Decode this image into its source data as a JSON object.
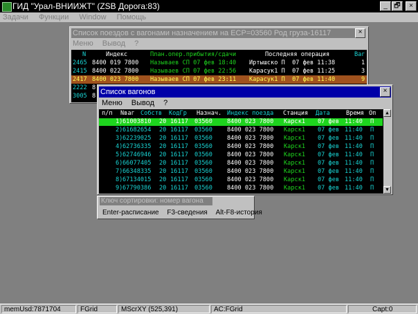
{
  "window": {
    "title": "ГИД \"Урал-ВНИИЖТ\" (ZSB Дорога:83)",
    "buttons": {
      "minimize": "_",
      "restore": "🗗",
      "close": "×"
    }
  },
  "menu": [
    "Задачи",
    "Функции",
    "Window",
    "Помощь"
  ],
  "trains": {
    "title": "Список поездов с вагонами назначением на ЕСР=03560 Род груза-16117",
    "menu": [
      "Меню",
      "Вывод",
      "?"
    ],
    "headers": [
      "N",
      "Индекс",
      "План.опер.прибытия/сдачи",
      "Последняя операция",
      "Ваг"
    ],
    "rows": [
      {
        "n": "2465",
        "index": "8400 019 7800",
        "plan": "Называев СП 07 фев 18:40",
        "last": "Иртышско П  07 фев 11:38",
        "vag": "1"
      },
      {
        "n": "2415",
        "index": "8400 022 7800",
        "plan": "Называев СП 07 фев 22:56",
        "last": "Карасук1 П  07 фев 11:25",
        "vag": "3"
      },
      {
        "n": "2417",
        "index": "8400 023 7800",
        "plan": "Называев СП 07 фев 23:11",
        "last": "Карасук1 П  07 фев 11:40",
        "vag": "9"
      },
      {
        "n": "2222",
        "index": "8",
        "plan": "",
        "last": "",
        "vag": ""
      },
      {
        "n": "3005",
        "index": "8",
        "plan": "",
        "last": "",
        "vag": ""
      }
    ],
    "colors": {
      "number": "#19d4d4",
      "index": "#ffffff",
      "plan": "#1ed41e",
      "last": "#ffffff",
      "selected_bg": "#a0521e",
      "selected_fg": "#ffff55"
    }
  },
  "wagons": {
    "title": "Список вагонов",
    "menu": [
      "Меню",
      "Вывод",
      "?"
    ],
    "headers": [
      "п/п",
      "Nваг",
      "Собств",
      "КодГр",
      "Назнач.",
      "Индекс поезда",
      "Станция",
      "Дата",
      "Время",
      "Оп"
    ],
    "rows": [
      {
        "pp": "1)",
        "nvag": "61003810",
        "own": "20",
        "kodgr": "16117",
        "naz": "03560",
        "idx": "8400 023 7800",
        "stn": "Карск1",
        "date": "07 фев",
        "time": "11:40",
        "op": "П"
      },
      {
        "pp": "2)",
        "nvag": "61682654",
        "own": "20",
        "kodgr": "16117",
        "naz": "03560",
        "idx": "8400 023 7800",
        "stn": "Карск1",
        "date": "07 фев",
        "time": "11:40",
        "op": "П"
      },
      {
        "pp": "3)",
        "nvag": "62239025",
        "own": "20",
        "kodgr": "16117",
        "naz": "03560",
        "idx": "8400 023 7800",
        "stn": "Карск1",
        "date": "07 фев",
        "time": "11:40",
        "op": "П"
      },
      {
        "pp": "4)",
        "nvag": "62736335",
        "own": "20",
        "kodgr": "16117",
        "naz": "03560",
        "idx": "8400 023 7800",
        "stn": "Карск1",
        "date": "07 фев",
        "time": "11:40",
        "op": "П"
      },
      {
        "pp": "5)",
        "nvag": "62746946",
        "own": "20",
        "kodgr": "16117",
        "naz": "03560",
        "idx": "8400 023 7800",
        "stn": "Карск1",
        "date": "07 фев",
        "time": "11:40",
        "op": "П"
      },
      {
        "pp": "6)",
        "nvag": "66077405",
        "own": "20",
        "kodgr": "16117",
        "naz": "03560",
        "idx": "8400 023 7800",
        "stn": "Карск1",
        "date": "07 фев",
        "time": "11:40",
        "op": "П"
      },
      {
        "pp": "7)",
        "nvag": "66348335",
        "own": "20",
        "kodgr": "16117",
        "naz": "03560",
        "idx": "8400 023 7800",
        "stn": "Карск1",
        "date": "07 фев",
        "time": "11:40",
        "op": "П"
      },
      {
        "pp": "8)",
        "nvag": "67134015",
        "own": "20",
        "kodgr": "16117",
        "naz": "03560",
        "idx": "8400 023 7800",
        "stn": "Карск1",
        "date": "07 фев",
        "time": "11:40",
        "op": "П"
      },
      {
        "pp": "9)",
        "nvag": "67790386",
        "own": "20",
        "kodgr": "16117",
        "naz": "03560",
        "idx": "8400 023 7800",
        "stn": "Карск1",
        "date": "07 фев",
        "time": "11:40",
        "op": "П"
      }
    ],
    "colors": {
      "text": "#19d4d4",
      "index": "#ffffff",
      "station": "#1ed41e",
      "header": "#ffffff",
      "selected_bg": "#1ed41e",
      "selected_fg": "#ffffff"
    }
  },
  "sort": {
    "key_label": "Ключ сортировки: номер вагона",
    "actions": [
      "Enter-расписание",
      "F3-сведения",
      "Alt-F8-история"
    ]
  },
  "status": {
    "mem": "memUsd:7871704",
    "grid": "FGrid",
    "mouse": "MScrXY (525,391)",
    "ac": "AC:FGrid",
    "capt": "Capt:0"
  }
}
